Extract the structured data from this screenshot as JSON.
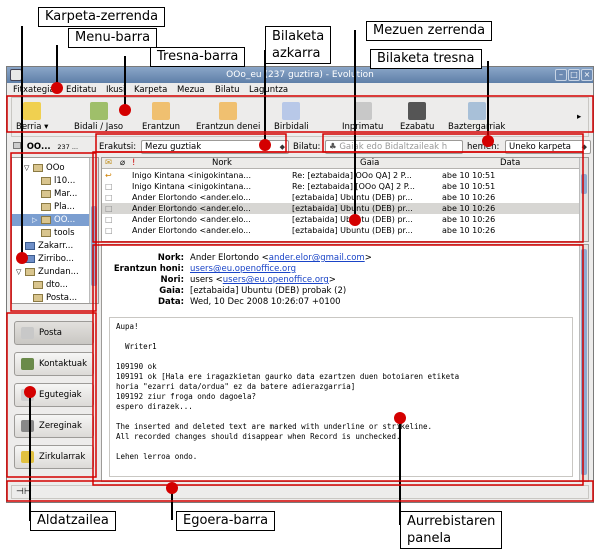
{
  "annotations": {
    "karpeta_zerrenda": "Karpeta-zerrenda",
    "menu_barra": "Menu-barra",
    "tresna_barra": "Tresna-barra",
    "bilaketa_azkarra": "Bilaketa\nazkarra",
    "mezuen_zerrenda": "Mezuen zerrenda",
    "bilaketa_tresna": "Bilaketa tresna",
    "aldatzailea": "Aldatzailea",
    "egoera_barra": "Egoera-barra",
    "aurrebistaren_panela": "Aurrebistaren\npanela"
  },
  "window": {
    "title": "OOo_eu (237 guztira) - Evolution"
  },
  "menubar": [
    "Fitxategia",
    "Editatu",
    "Ikusi",
    "Karpeta",
    "Mezua",
    "Bilatu",
    "Laguntza"
  ],
  "toolbar": {
    "new": "Berria",
    "send_receive": "Bidali / Jaso",
    "reply": "Erantzun",
    "reply_all": "Erantzun denei",
    "forward": "Birbidali",
    "print": "Inprimatu",
    "delete": "Ezabatu",
    "not_junk": "Baztergarriak"
  },
  "filterbar": {
    "folder_label": "OO...",
    "folder_count": "237 ...",
    "show_label": "Erakutsi:",
    "show_value": "Mezu guztiak",
    "search_label": "Bilatu:",
    "search_placeholder": "Gaiak edo Bidaltzaileak h",
    "in_label": "hemen:",
    "scope_value": "Uneko karpeta"
  },
  "folders": [
    {
      "name": "OOo",
      "indent": 1,
      "toggle": "▽",
      "color": "normal",
      "selected": false
    },
    {
      "name": "l10...",
      "indent": 2,
      "toggle": "",
      "color": "normal",
      "selected": false
    },
    {
      "name": "Mar...",
      "indent": 2,
      "toggle": "",
      "color": "normal",
      "selected": false
    },
    {
      "name": "Pla...",
      "indent": 2,
      "toggle": "",
      "color": "normal",
      "selected": false
    },
    {
      "name": "OO...",
      "indent": 2,
      "toggle": "▷",
      "color": "normal",
      "selected": true
    },
    {
      "name": "tools",
      "indent": 2,
      "toggle": "",
      "color": "normal",
      "selected": false
    },
    {
      "name": "Zakarr...",
      "indent": 0,
      "toggle": "",
      "color": "blue",
      "selected": false
    },
    {
      "name": "Zirribo...",
      "indent": 0,
      "toggle": "",
      "color": "blue",
      "selected": false
    },
    {
      "name": "Zundan...",
      "indent": 0,
      "toggle": "▽",
      "color": "normal",
      "selected": false
    },
    {
      "name": "dto...",
      "indent": 1,
      "toggle": "",
      "color": "normal",
      "selected": false
    },
    {
      "name": "Posta...",
      "indent": 1,
      "toggle": "",
      "color": "normal",
      "selected": false
    }
  ],
  "message_list": {
    "columns": {
      "from": "Nork",
      "subject": "Gaia",
      "date": "Data"
    },
    "rows": [
      {
        "from": "Inigo Kintana <inigokintana...",
        "subject": "Re: [eztabaida] OOo QA] 2 P...",
        "date": "abe 10 10:51",
        "selected": false,
        "flag": true
      },
      {
        "from": "Inigo Kintana <inigokintana...",
        "subject": "Re: [eztabaida] [OOo QA] 2 P...",
        "date": "abe 10 10:51",
        "selected": false,
        "flag": false
      },
      {
        "from": "Ander Elortondo <ander.elo...",
        "subject": "[eztabaida] Ubuntu (DEB) pr...",
        "date": "abe 10 10:26",
        "selected": false,
        "flag": false
      },
      {
        "from": "Ander Elortondo <ander.elo...",
        "subject": "[eztabaida] Ubuntu (DEB) pr...",
        "date": "abe 10 10:26",
        "selected": true,
        "flag": false
      },
      {
        "from": "Ander Elortondo <ander.elo...",
        "subject": "[eztabaida] Ubuntu (DEB) pr...",
        "date": "abe 10 10:26",
        "selected": false,
        "flag": false
      },
      {
        "from": "Ander Elortondo <ander.elo...",
        "subject": "[eztabaida] Ubuntu (DEB) pr...",
        "date": "abe 10 10:26",
        "selected": false,
        "flag": false
      }
    ]
  },
  "preview": {
    "from_label": "Nork:",
    "from_name": "Ander Elortondo <",
    "from_email": "ander.elor@gmail.com",
    "from_end": ">",
    "replyto_label": "Erantzun honi:",
    "replyto_email": "users@eu.openoffice.org",
    "to_label": "Nori:",
    "to_name": "users <",
    "to_email": "users@eu.openoffice.org",
    "to_end": ">",
    "subject_label": "Gaia:",
    "subject_value": "[eztabaida] Ubuntu (DEB) probak (2)",
    "date_label": "Data:",
    "date_value": "Wed, 10 Dec 2008 10:26:07 +0100",
    "body": "Aupa!\n\n  Writer1\n\n109190 ok\n109191 ok [Hala ere iragazkietan gaurko data ezartzen duen botoiaren etiketa\nhoria \"ezarri data/ordua\" ez da batere adierazgarria]\n109192 ziur froga ondo dagoela?\nespero dirazek...\n\nThe inserted and deleted text are marked with underline or strikeline.\nAll recorded changes should disappear when Record is unchecked.\n\nLehen lerroa ondo."
  },
  "switcher": [
    "Posta",
    "Kontaktuak",
    "Egutegiak",
    "Zereginak",
    "Zirkularrak"
  ],
  "colors": {
    "accent_red": "#d40000",
    "selection": "#7b9ed0",
    "titlebar": "#6d8bb3",
    "link": "#1a44c7"
  }
}
